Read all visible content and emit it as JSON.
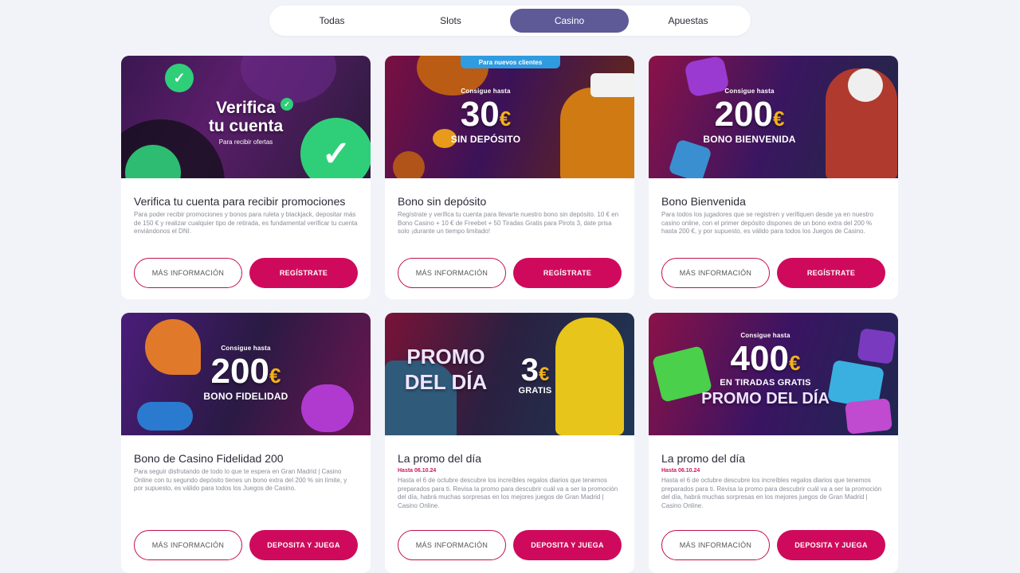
{
  "tabs": [
    {
      "label": "Todas"
    },
    {
      "label": "Slots"
    },
    {
      "label": "Casino",
      "active": true
    },
    {
      "label": "Apuestas"
    }
  ],
  "cards": [
    {
      "banner": {
        "headline_1": "Verifica",
        "headline_2": "tu cuenta",
        "sub": "Para recibir ofertas"
      },
      "title": "Verifica tu cuenta para recibir promociones",
      "desc": "Para poder recibir promociones y bonos para ruleta y blackjack, depositar más de 150 € y realizar cualquier tipo de retirada, es fundamental verificar tu cuenta enviándonos el DNI.",
      "btn_info": "MÁS INFORMACIÓN",
      "btn_action": "REGÍSTRATE"
    },
    {
      "banner": {
        "ribbon": "Para nuevos clientes",
        "top": "Consigue hasta",
        "amount": "30",
        "currency": "€",
        "sub": "SIN DEPÓSITO"
      },
      "title": "Bono sin depósito",
      "desc": "Regístrate y verifica tu cuenta para llevarte nuestro bono sin depósito. 10 € en Bono Casino + 10 € de Freebet + 50 Tiradas Gratis para Pirots 3, date prisa solo ¡durante un tiempo limitado!",
      "btn_info": "MÁS INFORMACIÓN",
      "btn_action": "REGÍSTRATE"
    },
    {
      "banner": {
        "top": "Consigue hasta",
        "amount": "200",
        "currency": "€",
        "sub": "BONO BIENVENIDA"
      },
      "title": "Bono Bienvenida",
      "desc": "Para todos los jugadores que se registren y verifiquen desde ya en nuestro casino online, con el primer depósito dispones de un bono extra del 200 % hasta 200 €, y por supuesto, es válido para todos los Juegos de Casino.",
      "btn_info": "MÁS INFORMACIÓN",
      "btn_action": "REGÍSTRATE"
    },
    {
      "banner": {
        "top": "Consigue hasta",
        "amount": "200",
        "currency": "€",
        "sub": "BONO FIDELIDAD"
      },
      "title": "Bono de Casino Fidelidad 200",
      "desc": "Para seguir disfrutando de todo lo que te espera en Gran Madrid | Casino Online con tu segundo depósito tienes un bono extra del 200 % sin límite, y por supuesto, es válido para todos los Juegos de Casino.",
      "btn_info": "MÁS INFORMACIÓN",
      "btn_action": "DEPOSITA Y JUEGA"
    },
    {
      "banner": {
        "promo_1": "PROMO",
        "promo_2": "DEL DÍA",
        "amount": "3",
        "currency": "€",
        "sub": "GRATIS"
      },
      "title": "La promo del día",
      "date": "Hasta 06.10.24",
      "desc": "Hasta el 6 de octubre descubre los increíbles regalos diarios que tenemos preparados para ti. Revisa la promo para descubrir cuál va a ser la promoción del día, habrá muchas sorpresas en los mejores juegos de Gran Madrid | Casino Online.",
      "btn_info": "MÁS INFORMACIÓN",
      "btn_action": "DEPOSITA Y JUEGA"
    },
    {
      "banner": {
        "top": "Consigue hasta",
        "amount": "400",
        "currency": "€",
        "sub": "EN TIRADAS GRATIS",
        "promo": "PROMO DEL DÍA"
      },
      "title": "La promo del día",
      "date": "Hasta 06.10.24",
      "desc": "Hasta el 6 de octubre descubre los increíbles regalos diarios que tenemos preparados para ti. Revisa la promo para descubrir cuál va a ser la promoción del día, habrá muchas sorpresas en los mejores juegos de Gran Madrid | Casino Online.",
      "btn_info": "MÁS INFORMACIÓN",
      "btn_action": "DEPOSITA Y JUEGA"
    }
  ],
  "colors": {
    "accent": "#cf0a5c",
    "tab_active": "#5d5a97",
    "background": "#f1f3f8"
  }
}
